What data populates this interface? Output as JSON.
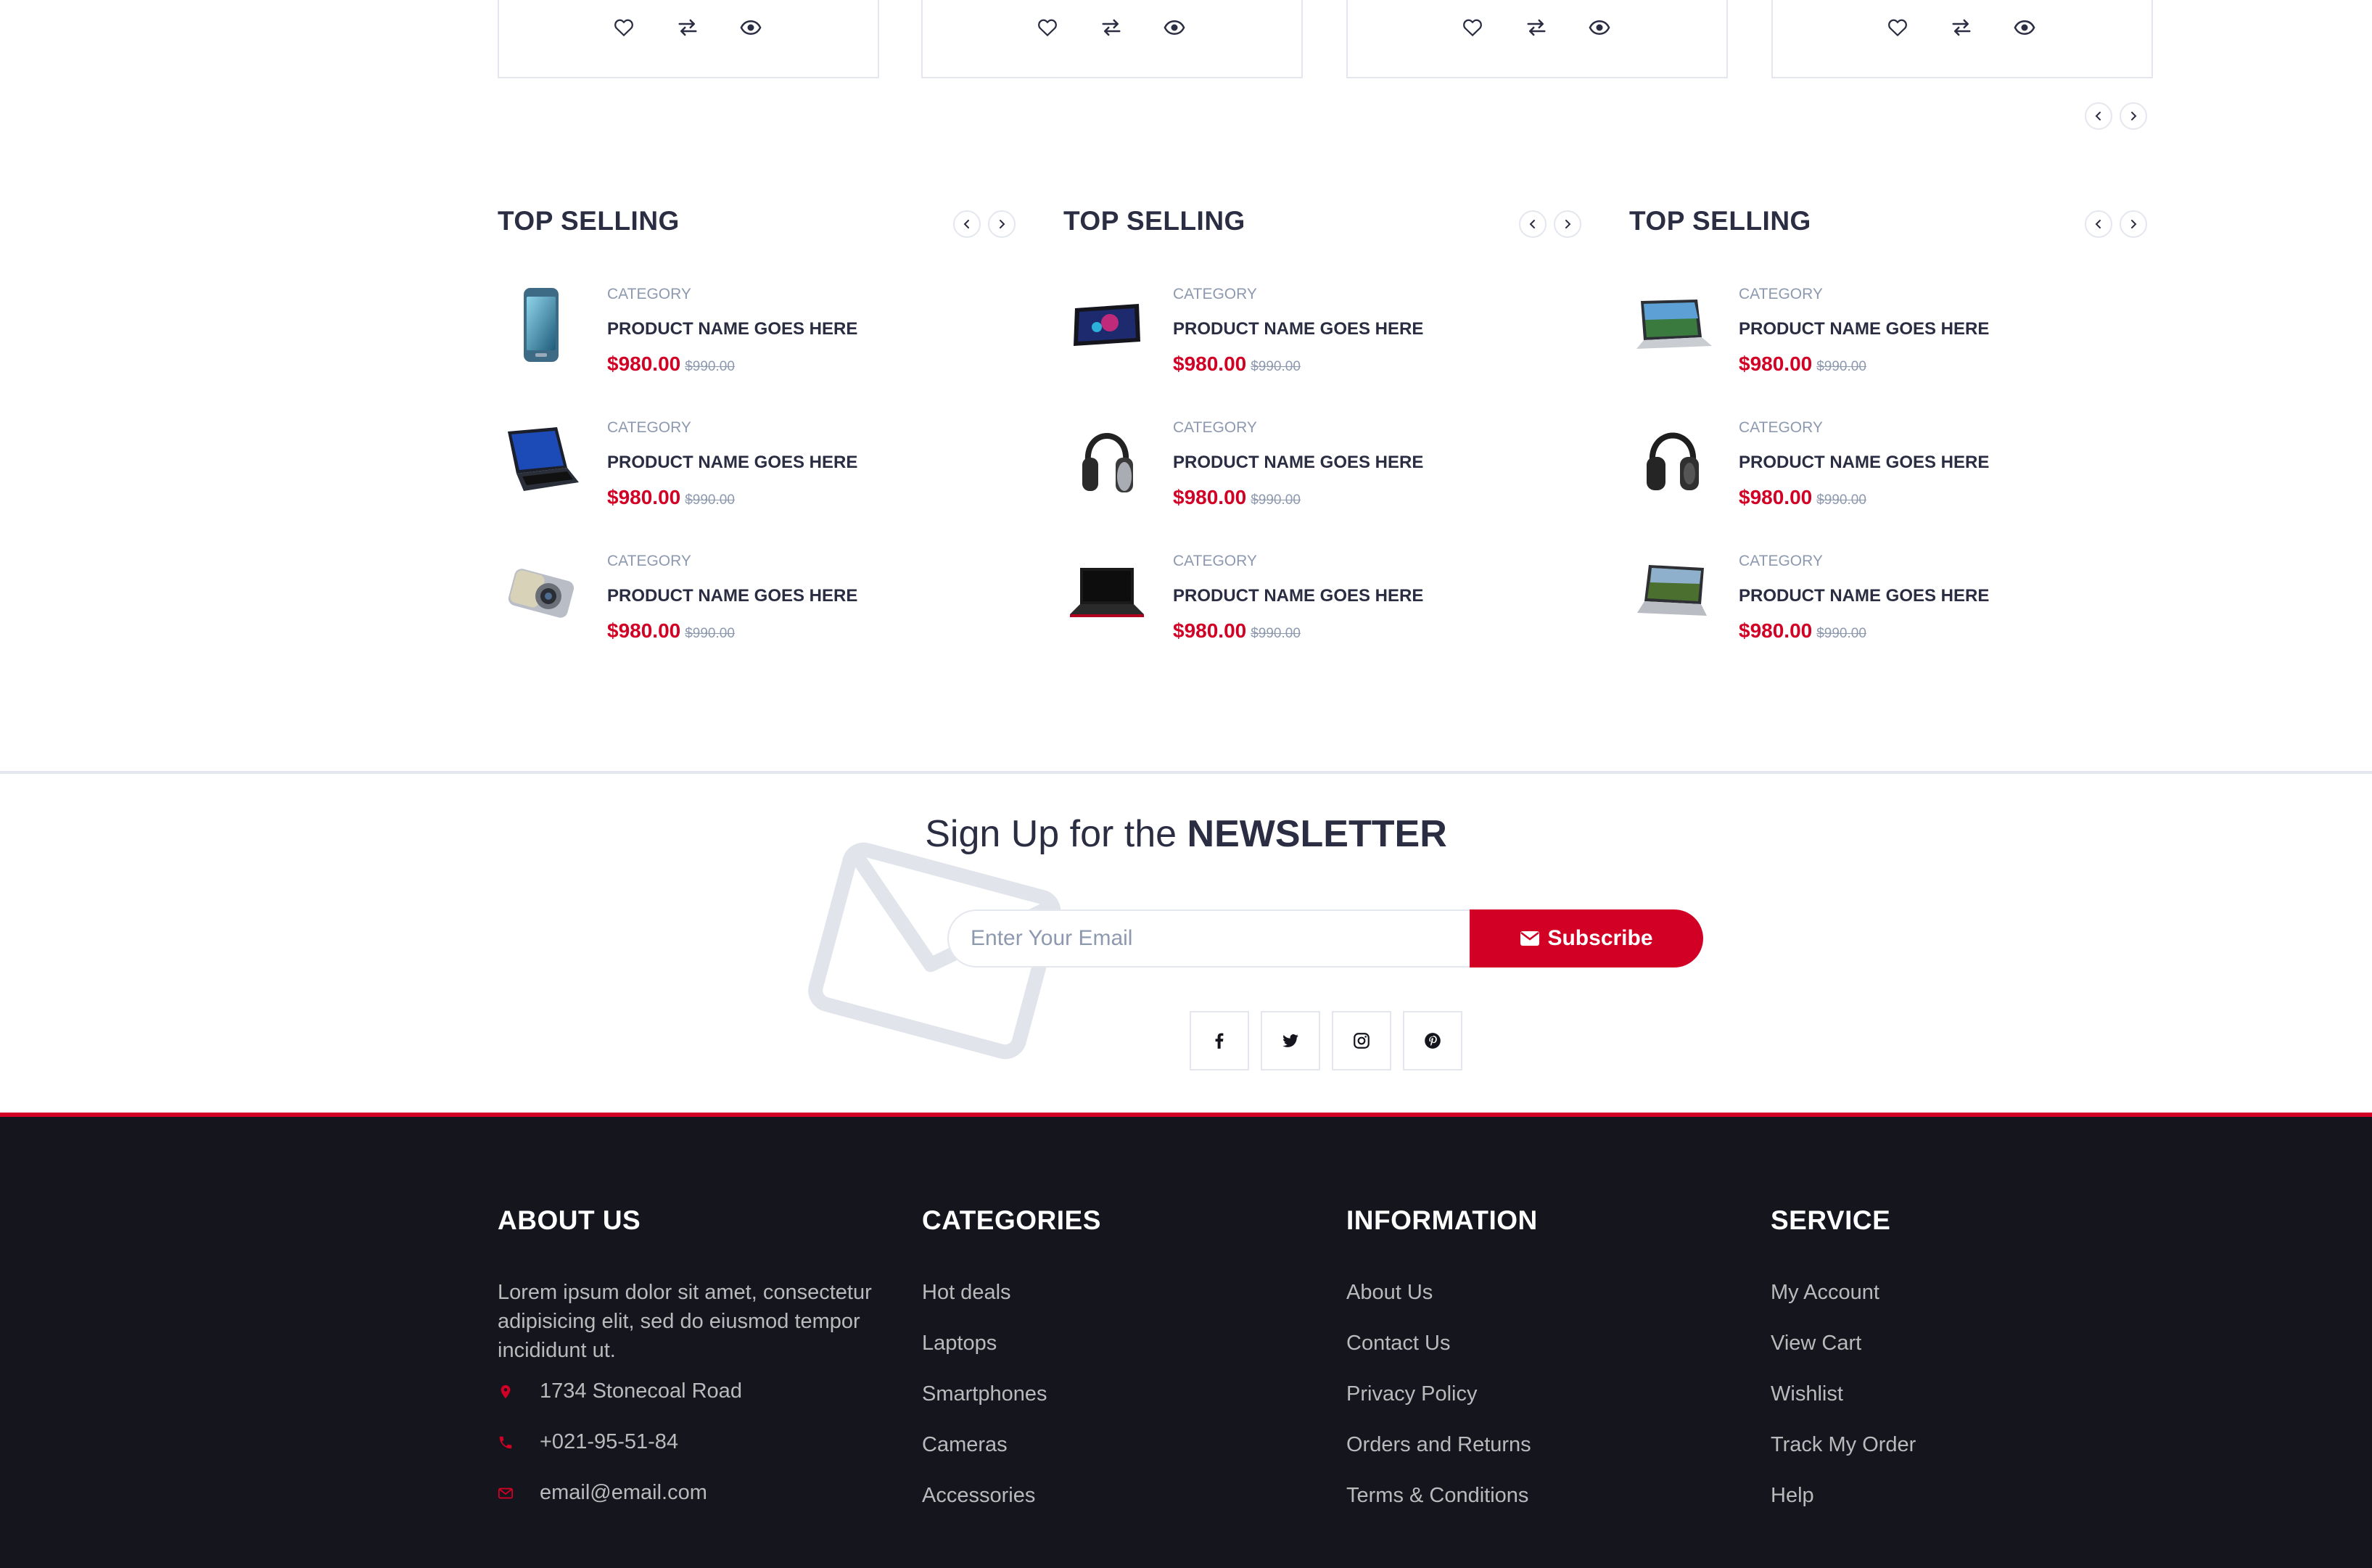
{
  "colors": {
    "accent": "#d10024",
    "heading": "#2b2d42",
    "muted": "#8d99ae",
    "footer_bg": "#15161d",
    "border": "#e4e7ed"
  },
  "product_cards": [
    {
      "actions": [
        "heart-icon",
        "exchange-icon",
        "eye-icon"
      ]
    },
    {
      "actions": [
        "heart-icon",
        "exchange-icon",
        "eye-icon"
      ]
    },
    {
      "actions": [
        "heart-icon",
        "exchange-icon",
        "eye-icon"
      ]
    },
    {
      "actions": [
        "heart-icon",
        "exchange-icon",
        "eye-icon"
      ]
    }
  ],
  "widgets": [
    {
      "title": "TOP SELLING",
      "items": [
        {
          "image": "smartphone",
          "category": "CATEGORY",
          "name": "PRODUCT NAME GOES HERE",
          "price": "$980.00",
          "old_price": "$990.00"
        },
        {
          "image": "laptop-blue",
          "category": "CATEGORY",
          "name": "PRODUCT NAME GOES HERE",
          "price": "$980.00",
          "old_price": "$990.00"
        },
        {
          "image": "camera",
          "category": "CATEGORY",
          "name": "PRODUCT NAME GOES HERE",
          "price": "$980.00",
          "old_price": "$990.00"
        }
      ]
    },
    {
      "title": "TOP SELLING",
      "items": [
        {
          "image": "tablet",
          "category": "CATEGORY",
          "name": "PRODUCT NAME GOES HERE",
          "price": "$980.00",
          "old_price": "$990.00"
        },
        {
          "image": "headphones",
          "category": "CATEGORY",
          "name": "PRODUCT NAME GOES HERE",
          "price": "$980.00",
          "old_price": "$990.00"
        },
        {
          "image": "laptop-black",
          "category": "CATEGORY",
          "name": "PRODUCT NAME GOES HERE",
          "price": "$980.00",
          "old_price": "$990.00"
        }
      ]
    },
    {
      "title": "TOP SELLING",
      "items": [
        {
          "image": "laptop-silver",
          "category": "CATEGORY",
          "name": "PRODUCT NAME GOES HERE",
          "price": "$980.00",
          "old_price": "$990.00"
        },
        {
          "image": "headphones",
          "category": "CATEGORY",
          "name": "PRODUCT NAME GOES HERE",
          "price": "$980.00",
          "old_price": "$990.00"
        },
        {
          "image": "laptop-silver",
          "category": "CATEGORY",
          "name": "PRODUCT NAME GOES HERE",
          "price": "$980.00",
          "old_price": "$990.00"
        }
      ]
    }
  ],
  "newsletter": {
    "title_prefix": "Sign Up for the ",
    "title_bold": "NEWSLETTER",
    "email_placeholder": "Enter Your Email",
    "subscribe_label": "Subscribe",
    "social": [
      "facebook-icon",
      "twitter-icon",
      "instagram-icon",
      "pinterest-icon"
    ]
  },
  "footer": {
    "about": {
      "title": "ABOUT US",
      "text": "Lorem ipsum dolor sit amet, consectetur adipisicing elit, sed do eiusmod tempor incididunt ut.",
      "address": "1734 Stonecoal Road",
      "phone": "+021-95-51-84",
      "email": "email@email.com"
    },
    "categories": {
      "title": "CATEGORIES",
      "links": [
        "Hot deals",
        "Laptops",
        "Smartphones",
        "Cameras",
        "Accessories"
      ]
    },
    "information": {
      "title": "INFORMATION",
      "links": [
        "About Us",
        "Contact Us",
        "Privacy Policy",
        "Orders and Returns",
        "Terms & Conditions"
      ]
    },
    "service": {
      "title": "SERVICE",
      "links": [
        "My Account",
        "View Cart",
        "Wishlist",
        "Track My Order",
        "Help"
      ]
    }
  }
}
